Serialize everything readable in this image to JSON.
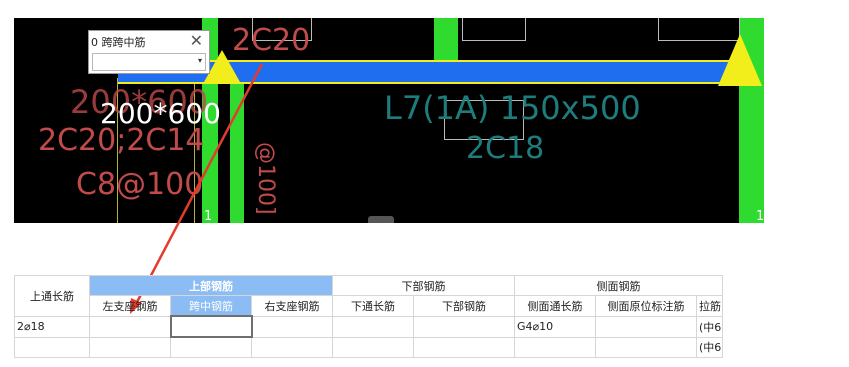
{
  "popup": {
    "title": "0 跨跨中筋",
    "close_glyph": "✕",
    "dropdown_value": "",
    "dropdown_arrow": "▾"
  },
  "cad": {
    "labels": {
      "beam_top_rebar": "2C20",
      "section": "200*600",
      "ghost_section": "200*600",
      "side_rebar": "2C20;2C14",
      "stirrup": "C8@100",
      "beam_name": "L7(1A) 150x500",
      "beam_rebar": "2C18",
      "vertical_text": "@100]",
      "col_mark_left": "1",
      "col_mark_right": "1"
    },
    "colors": {
      "background": "#000000",
      "column_green": "#2edb2e",
      "beam_blue": "#1f6ef0",
      "triangle_yellow": "#f1ee1c",
      "text_red": "#c14a4a",
      "text_teal": "#1f7c7c",
      "arrow_red": "#e53b2c"
    }
  },
  "table": {
    "header_groups": {
      "top_rebar": "上部钢筋",
      "bottom_rebar": "下部钢筋",
      "side_rebar": "侧面钢筋"
    },
    "columns": {
      "top_through": "上通长筋",
      "left_support": "左支座钢筋",
      "mid_span": "跨中钢筋",
      "right_support": "右支座钢筋",
      "bottom_through": "下通长筋",
      "bottom_rebar": "下部钢筋",
      "side_through": "侧面通长筋",
      "side_original": "侧面原位标注筋",
      "tie_bar": "拉筋"
    },
    "rows": [
      {
        "top_through": "2⌀18",
        "left_support": "",
        "mid_span": "",
        "right_support": "",
        "bottom_through": "",
        "bottom_rebar": "",
        "side_through": "G4⌀10",
        "side_original": "",
        "tie_bar": "(中6"
      },
      {
        "top_through": "",
        "left_support": "",
        "mid_span": "",
        "right_support": "",
        "bottom_through": "",
        "bottom_rebar": "",
        "side_through": "",
        "side_original": "",
        "tie_bar": "(中6"
      }
    ]
  }
}
